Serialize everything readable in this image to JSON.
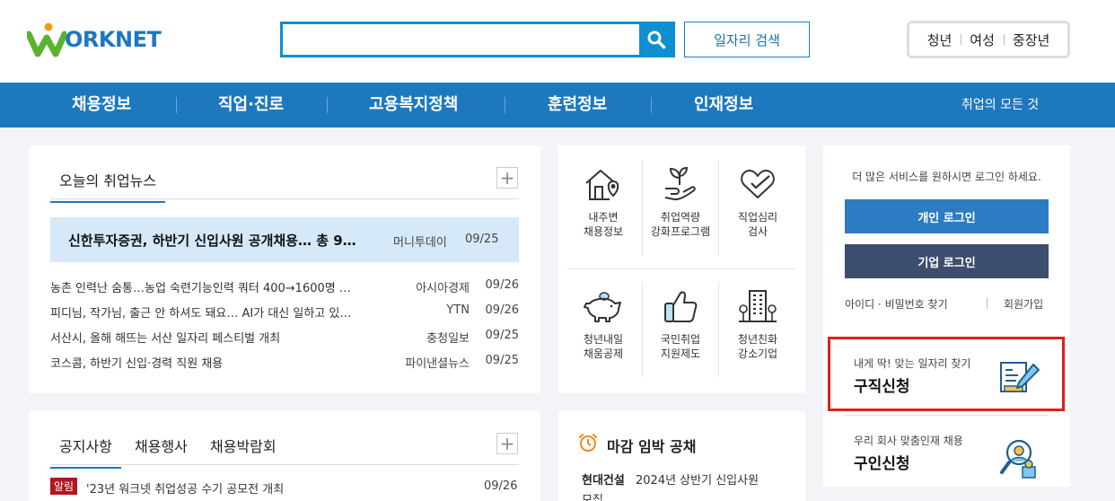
{
  "header": {
    "logo_text": "ORKNET",
    "search": {
      "placeholder": "",
      "value": ""
    },
    "job_search_label": "일자리 검색",
    "target_tabs": [
      "청년",
      "여성",
      "중장년"
    ]
  },
  "nav": {
    "items": [
      "채용정보",
      "직업·진로",
      "고용복지정책",
      "훈련정보",
      "인재정보"
    ],
    "extra": "취업의 모든 것"
  },
  "news": {
    "tab_label": "오늘의 취업뉴스",
    "highlight": {
      "title": "신한투자증권, 하반기 신입사원 공개채용… 총 9…",
      "source": "머니투데이",
      "date": "09/25"
    },
    "items": [
      {
        "title": "농촌 인력난 숨통…농업 숙련기능인력 쿼터 400→1600명 …",
        "source": "아시아경제",
        "date": "09/26"
      },
      {
        "title": "피디님, 작가님, 출근 안 하셔도 돼요… AI가 대신 일하고 있…",
        "source": "YTN",
        "date": "09/26"
      },
      {
        "title": "서산시, 올해 해뜨는 서산 일자리 페스티벌 개최",
        "source": "충청일보",
        "date": "09/25"
      },
      {
        "title": "코스콤, 하반기 신입·경력 직원 채용",
        "source": "파이낸셜뉴스",
        "date": "09/25"
      }
    ]
  },
  "services": [
    {
      "line1": "내주변",
      "line2": "채용정보",
      "icon": "house-location-icon"
    },
    {
      "line1": "취업역량",
      "line2": "강화프로그램",
      "icon": "sprout-hand-icon"
    },
    {
      "line1": "직업심리",
      "line2": "검사",
      "icon": "heart-check-icon"
    },
    {
      "line1": "청년내일",
      "line2": "채움공제",
      "icon": "piggy-bank-icon"
    },
    {
      "line1": "국민취업",
      "line2": "지원제도",
      "icon": "thumbs-up-icon"
    },
    {
      "line1": "청년친화",
      "line2": "강소기업",
      "icon": "building-icon"
    }
  ],
  "login": {
    "message": "더 많은 서비스를 원하시면 로그인 하세요.",
    "personal_label": "개인 로그인",
    "company_label": "기업 로그인",
    "find_label": "아이디 · 비밀번호 찾기",
    "join_label": "회원가입",
    "colors": {
      "personal": "#2b7cc2",
      "company": "#3d4e6e"
    }
  },
  "job_apply": {
    "sub": "내게 딱! 맞는 일자리 찾기",
    "main": "구직신청"
  },
  "recruit_apply": {
    "sub": "우리 회사 맞춤인재 채용",
    "main": "구인신청"
  },
  "notice": {
    "tabs": [
      "공지사항",
      "채용행사",
      "채용박람회"
    ],
    "badge": "알림",
    "title": "'23년 워크넷 취업성공 수기 공모전 개최",
    "date": "09/26"
  },
  "deadline": {
    "title": "마감 임박 공채",
    "company": "현대건설",
    "job": "2024년 상반기 신입사원",
    "job_cont": "모집"
  }
}
